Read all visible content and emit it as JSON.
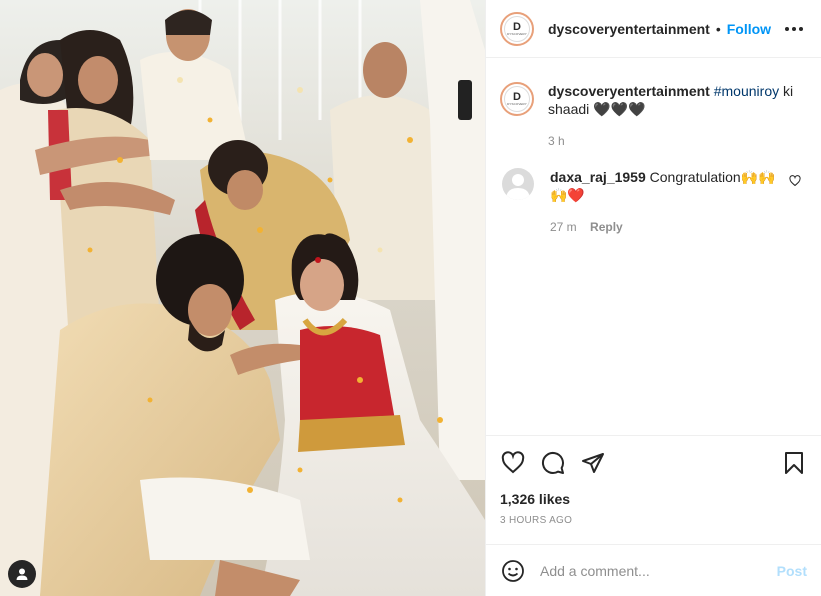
{
  "post": {
    "photo_alt": "",
    "tag_icon": "user-icon"
  },
  "header": {
    "username": "dyscoveryentertainment",
    "separator": "•",
    "follow_label": "Follow",
    "more_icon": "more-horizontal-icon"
  },
  "caption": {
    "username": "dyscoveryentertainment",
    "hashtag": "#mouniroy",
    "text": " ki shaadi 🖤🖤🖤",
    "age": "3 h"
  },
  "comments": [
    {
      "username": "daxa_raj_1959",
      "text": " Congratulation🙌🙌 🙌❤️",
      "age": "27 m",
      "reply_label": "Reply"
    }
  ],
  "actions": {
    "like_icon": "heart-icon",
    "comment_icon": "comment-icon",
    "share_icon": "share-icon",
    "save_icon": "bookmark-icon"
  },
  "likes_label": "1,326 likes",
  "timestamp": "3 HOURS AGO",
  "add_comment": {
    "placeholder": "Add a comment...",
    "post_label": "Post",
    "emoji_icon": "emoji-icon"
  },
  "colors": {
    "follow": "#0095f6",
    "post_disabled": "#b2dffc",
    "meta": "#8e8e8e",
    "hashtag": "#00376b",
    "border": "#efefef"
  }
}
